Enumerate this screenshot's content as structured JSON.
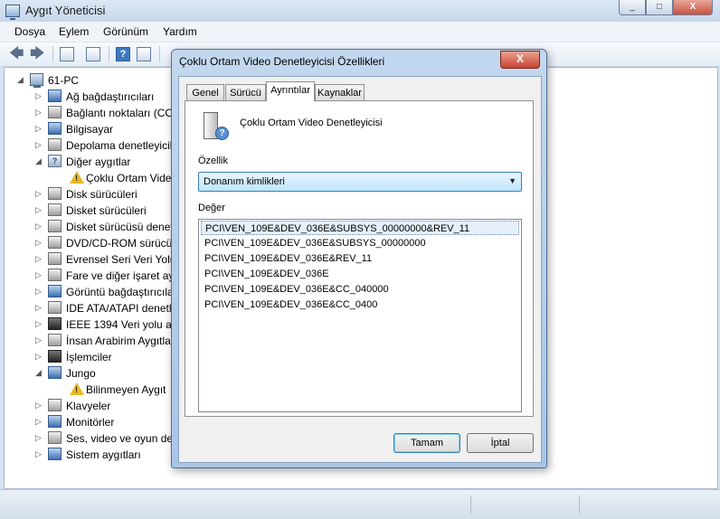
{
  "window": {
    "title": "Aygıt Yöneticisi",
    "min": "_",
    "max": "□",
    "close": "X"
  },
  "menu": [
    "Dosya",
    "Eylem",
    "Görünüm",
    "Yardım"
  ],
  "toolbar": {
    "back": "🡄",
    "forward": "🡆",
    "help": "?"
  },
  "tree": {
    "root": "61-PC",
    "items": [
      {
        "label": "Ağ bağdaştırıcıları",
        "icon": "network-adapter-icon",
        "expander": "▷"
      },
      {
        "label": "Bağlantı noktaları (COM ve LPT)",
        "icon": "port-icon",
        "expander": "▷"
      },
      {
        "label": "Bilgisayar",
        "icon": "computer-icon",
        "expander": "▷"
      },
      {
        "label": "Depolama denetleyicileri",
        "icon": "storage-controller-icon",
        "expander": "▷"
      },
      {
        "label": "Diğer aygıtlar",
        "icon": "other-devices-icon",
        "expander": "◢"
      },
      {
        "label": "Çoklu Ortam Video Denetleyicisi",
        "icon": "warning-icon",
        "child": true
      },
      {
        "label": "Disk sürücüleri",
        "icon": "disk-drive-icon",
        "expander": "▷"
      },
      {
        "label": "Disket sürücüleri",
        "icon": "floppy-drive-icon",
        "expander": "▷"
      },
      {
        "label": "Disket sürücüsü denetleyicileri",
        "icon": "floppy-controller-icon",
        "expander": "▷"
      },
      {
        "label": "DVD/CD-ROM sürücüleri",
        "icon": "dvd-drive-icon",
        "expander": "▷"
      },
      {
        "label": "Evrensel Seri Veri Yolu denetleyicileri",
        "icon": "usb-icon",
        "expander": "▷"
      },
      {
        "label": "Fare ve diğer işaret aygıtları",
        "icon": "mouse-icon",
        "expander": "▷"
      },
      {
        "label": "Görüntü bağdaştırıcıları",
        "icon": "display-adapter-icon",
        "expander": "▷"
      },
      {
        "label": "IDE ATA/ATAPI denetleyicileri",
        "icon": "ide-controller-icon",
        "expander": "▷"
      },
      {
        "label": "IEEE 1394 Veri yolu ana denetleyicileri",
        "icon": "ieee1394-icon",
        "expander": "▷"
      },
      {
        "label": "İnsan Arabirim Aygıtları",
        "icon": "hid-icon",
        "expander": "▷"
      },
      {
        "label": "İşlemciler",
        "icon": "processor-icon",
        "expander": "▷"
      },
      {
        "label": "Jungo",
        "icon": "jungo-icon",
        "expander": "◢"
      },
      {
        "label": "Bilinmeyen Aygıt",
        "icon": "warning-icon",
        "child": true
      },
      {
        "label": "Klavyeler",
        "icon": "keyboard-icon",
        "expander": "▷"
      },
      {
        "label": "Monitörler",
        "icon": "monitor-icon",
        "expander": "▷"
      },
      {
        "label": "Ses, video ve oyun denetleyicileri",
        "icon": "sound-icon",
        "expander": "▷"
      },
      {
        "label": "Sistem aygıtları",
        "icon": "system-devices-icon",
        "expander": "▷"
      }
    ]
  },
  "dialog": {
    "title": "Çoklu Ortam Video Denetleyicisi Özellikleri",
    "close": "X",
    "tabs": [
      "Genel",
      "Sürücü",
      "Ayrıntılar",
      "Kaynaklar"
    ],
    "device_name": "Çoklu Ortam Video Denetleyicisi",
    "property_label": "Özellik",
    "property_value": "Donanım kimlikleri",
    "value_label": "Değer",
    "values": [
      "PCI\\VEN_109E&DEV_036E&SUBSYS_00000000&REV_11",
      "PCI\\VEN_109E&DEV_036E&SUBSYS_00000000",
      "PCI\\VEN_109E&DEV_036E&REV_11",
      "PCI\\VEN_109E&DEV_036E",
      "PCI\\VEN_109E&DEV_036E&CC_040000",
      "PCI\\VEN_109E&DEV_036E&CC_0400"
    ],
    "ok": "Tamam",
    "cancel": "İptal"
  }
}
